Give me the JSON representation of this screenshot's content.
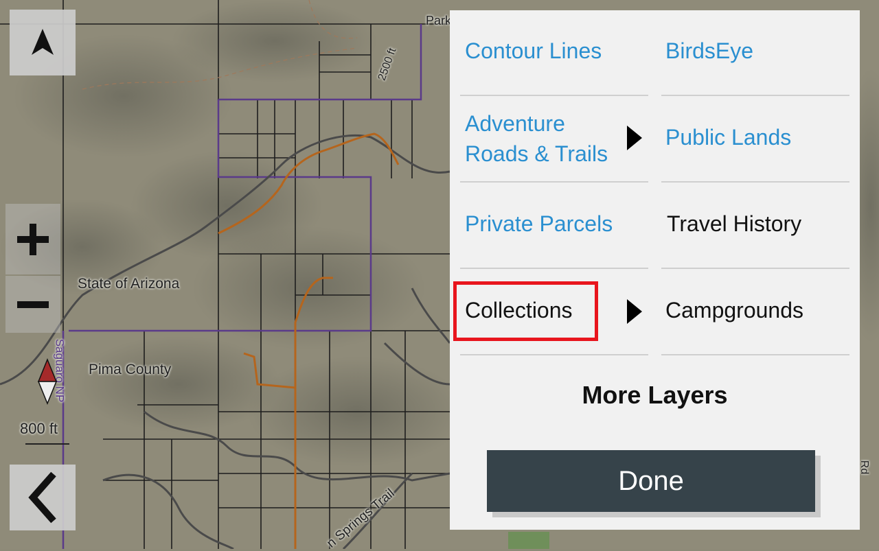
{
  "map": {
    "labels": {
      "state": "State of Arizona",
      "county": "Pima County",
      "park": "Saguaro NP",
      "elevation": "2500 ft",
      "trail": "n Springs Trail",
      "park_top": "Park",
      "road_right": "Rd",
      "scale": "800 ft"
    },
    "icons": {
      "north": "north-arrow-icon",
      "zoom_in": "plus-icon",
      "zoom_out": "minus-icon",
      "compass": "compass-icon",
      "back": "chevron-left-icon"
    }
  },
  "layers_panel": {
    "items": [
      {
        "label": "Contour Lines",
        "color": "#2a8fd0"
      },
      {
        "label": "BirdsEye",
        "color": "#2a8fd0"
      },
      {
        "label": "Adventure\nRoads & Trails",
        "color": "#2a8fd0"
      },
      {
        "label": "Public Lands",
        "color": "#2a8fd0"
      },
      {
        "label": "Private Parcels",
        "color": "#2a8fd0"
      },
      {
        "label": "Travel History",
        "color": "#111111"
      },
      {
        "label": "Collections",
        "color": "#111111"
      },
      {
        "label": "Campgrounds",
        "color": "#111111"
      }
    ],
    "more_layers": "More Layers",
    "done": "Done"
  },
  "colors": {
    "highlight": "#e8151d",
    "active_layer": "#2a8fd0",
    "done_button": "#36434a"
  }
}
